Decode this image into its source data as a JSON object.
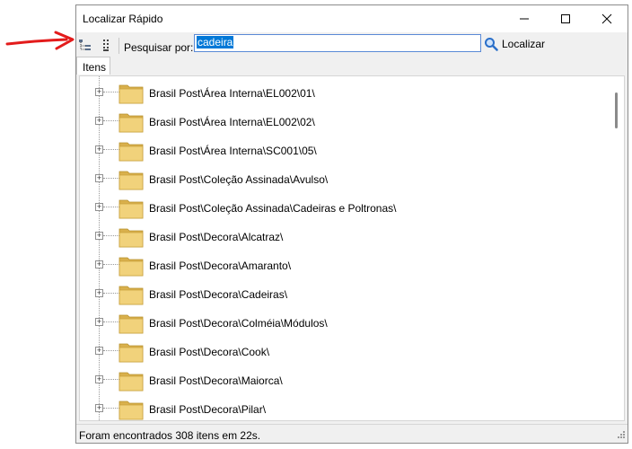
{
  "window": {
    "title": "Localizar Rápido",
    "minimize_icon": "minimize-icon",
    "maximize_icon": "maximize-icon",
    "close_icon": "close-icon"
  },
  "toolbar": {
    "icon1": "tree-view-icon",
    "icon2": "list-view-icon",
    "search_label": "Pesquisar por:",
    "search_value": "cadeira",
    "find_label": "Localizar",
    "find_icon": "magnifier-icon"
  },
  "tabs": [
    {
      "label": "Itens",
      "active": true
    }
  ],
  "tree": {
    "items": [
      {
        "label": "Brasil Post\\Área Interna\\EL002\\01\\"
      },
      {
        "label": "Brasil Post\\Área Interna\\EL002\\02\\"
      },
      {
        "label": "Brasil Post\\Área Interna\\SC001\\05\\"
      },
      {
        "label": "Brasil Post\\Coleção Assinada\\Avulso\\"
      },
      {
        "label": "Brasil Post\\Coleção Assinada\\Cadeiras e Poltronas\\"
      },
      {
        "label": "Brasil Post\\Decora\\Alcatraz\\"
      },
      {
        "label": "Brasil Post\\Decora\\Amaranto\\"
      },
      {
        "label": "Brasil Post\\Decora\\Cadeiras\\"
      },
      {
        "label": "Brasil Post\\Decora\\Colméia\\Módulos\\"
      },
      {
        "label": "Brasil Post\\Decora\\Cook\\"
      },
      {
        "label": "Brasil Post\\Decora\\Maiorca\\"
      },
      {
        "label": "Brasil Post\\Decora\\Pilar\\"
      }
    ]
  },
  "status": {
    "text": "Foram encontrados 308 itens em 22s."
  },
  "annotation": {
    "arrow_color": "#e31b1b"
  },
  "colors": {
    "accent": "#0078d7",
    "folder": "#e8c66a"
  }
}
